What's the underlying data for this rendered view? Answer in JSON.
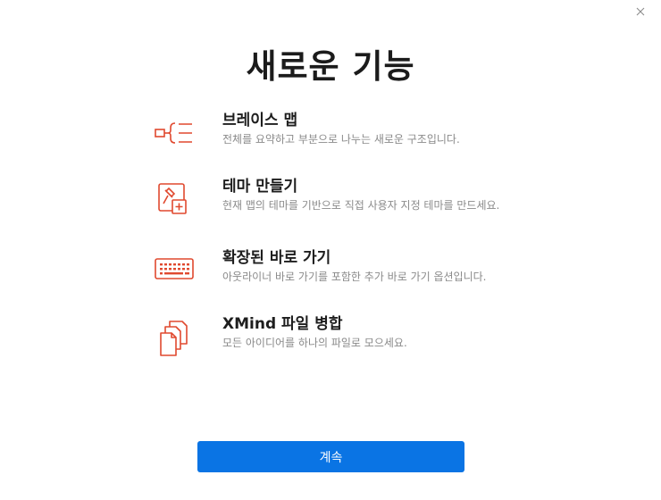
{
  "dialog": {
    "title": "새로운 기능",
    "close_icon": "close-icon",
    "accent_color": "#e0492f",
    "button_color": "#0a74e4",
    "features": [
      {
        "icon": "brace-structure-icon",
        "title": "브레이스 맵",
        "description": "전체를 요약하고 부분으로 나누는 새로운 구조입니다."
      },
      {
        "icon": "theme-edit-icon",
        "title": "테마 만들기",
        "description": "현재 맵의 테마를 기반으로 직접 사용자 지정 테마를 만드세요."
      },
      {
        "icon": "keyboard-icon",
        "title": "확장된 바로 가기",
        "description": "아웃라이너 바로 가기를 포함한 추가 바로 가기 옵션입니다."
      },
      {
        "icon": "merge-files-icon",
        "title": "XMind 파일 병합",
        "description": "모든 아이디어를 하나의 파일로 모으세요."
      }
    ],
    "continue_label": "계속"
  }
}
